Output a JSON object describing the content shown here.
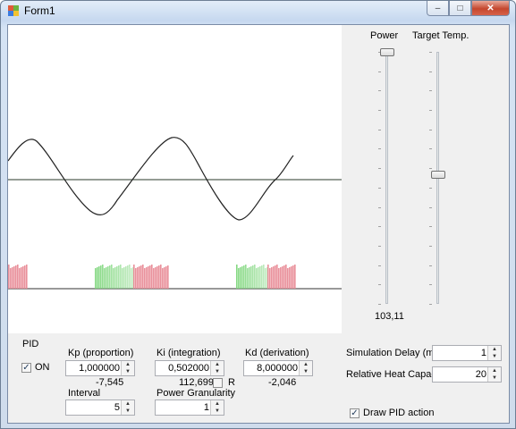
{
  "window": {
    "title": "Form1"
  },
  "plot": {
    "setpoint_line": true,
    "curve_color": "#222222",
    "heat_color": "#e88a96",
    "cool_color": "#7ed67c"
  },
  "sliders": {
    "power": {
      "label": "Power",
      "value_text": "103,11",
      "level": 0.0
    },
    "target": {
      "label": "Target Temp.",
      "level": 0.5
    }
  },
  "pid": {
    "group_label": "PID",
    "on": {
      "label": "ON",
      "checked": true
    },
    "kp": {
      "label": "Kp (proportion)",
      "value": "1,000000",
      "readout": "-7,545"
    },
    "ki": {
      "label": "Ki (integration)",
      "value": "0,502000",
      "readout": "112,699",
      "r_label": "R",
      "r_checked": false
    },
    "kd": {
      "label": "Kd (derivation)",
      "value": "8,000000",
      "readout": "-2,046"
    },
    "interval": {
      "label": "Interval",
      "value": "5"
    },
    "granularity": {
      "label": "Power Granularity",
      "value": "1"
    }
  },
  "simulation": {
    "delay": {
      "label": "Simulation Delay (ms)",
      "value": "1"
    },
    "heat_capacity": {
      "label": "Relative Heat Capacity",
      "value": "20"
    },
    "draw_pid": {
      "label": "Draw PID action",
      "checked": true
    }
  },
  "caption_buttons": {
    "minimize": "minimize-icon",
    "maximize": "maximize-icon",
    "close": "close-icon"
  }
}
